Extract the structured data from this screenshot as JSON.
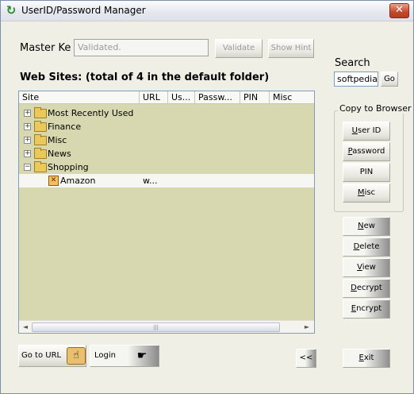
{
  "window": {
    "title": "UserID/Password Manager",
    "close_label": "✕"
  },
  "master": {
    "label": "Master Ke",
    "value": "Validated.",
    "validate_label": "Validate",
    "show_hint_label": "Show Hint"
  },
  "websites": {
    "heading": "Web Sites: (total of 4 in the default folder)",
    "columns": [
      "Site",
      "URL",
      "Us...",
      "Passw...",
      "PIN",
      "Misc"
    ],
    "folders": [
      {
        "label": "Most Recently Used",
        "expander": "+"
      },
      {
        "label": "Finance",
        "expander": "+"
      },
      {
        "label": "Misc",
        "expander": "+"
      },
      {
        "label": "News",
        "expander": "+"
      },
      {
        "label": "Shopping",
        "expander": "−"
      }
    ],
    "entry": {
      "site": "Amazon",
      "url": "w..."
    },
    "scroll_left": "◄",
    "scroll_right": "►",
    "scroll_grip": "|||"
  },
  "search": {
    "label": "Search",
    "value": "softpedia",
    "go_label": "Go"
  },
  "copy_to_browser": {
    "legend": "Copy to Browser",
    "user_id": "User ID",
    "password": "Password",
    "pin": "PIN",
    "misc": "Misc"
  },
  "actions": {
    "new": "New",
    "delete": "Delete",
    "view": "View",
    "decrypt": "Decrypt",
    "encrypt": "Encrypt",
    "go_to_url": "Go to URL",
    "login": "Login",
    "collapse": "<<",
    "exit": "Exit"
  }
}
